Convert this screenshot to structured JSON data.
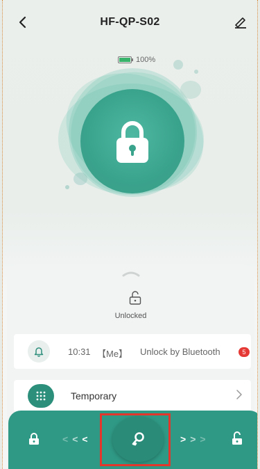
{
  "header": {
    "title": "HF-QP-S02",
    "back_icon": "chevron-left-icon",
    "edit_icon": "pencil-icon"
  },
  "battery": {
    "level_text": "100%",
    "level_fraction": 1.0,
    "fill_color": "#38b36a"
  },
  "lock_visual": {
    "icon": "padlock-icon",
    "accent": "#3aa38c"
  },
  "status": {
    "icon": "unlocked-padlock-icon",
    "text": "Unlocked"
  },
  "log": {
    "icon": "bell-icon",
    "time": "10:31",
    "user": "【Me】",
    "action": "Unlock by Bluetooth",
    "badge_count": "5",
    "badge_color": "#e53935"
  },
  "temporary": {
    "icon": "keypad-icon",
    "label": "Temporary",
    "chevron": "chevron-right-icon"
  },
  "bottom_bar": {
    "color": "#2f9985",
    "left_icon": "lock-icon",
    "right_icon": "unlock-icon",
    "center_icon": "key-icon",
    "arrows_left": [
      "<",
      "<",
      "<"
    ],
    "arrows_right": [
      ">",
      ">",
      ">"
    ]
  }
}
